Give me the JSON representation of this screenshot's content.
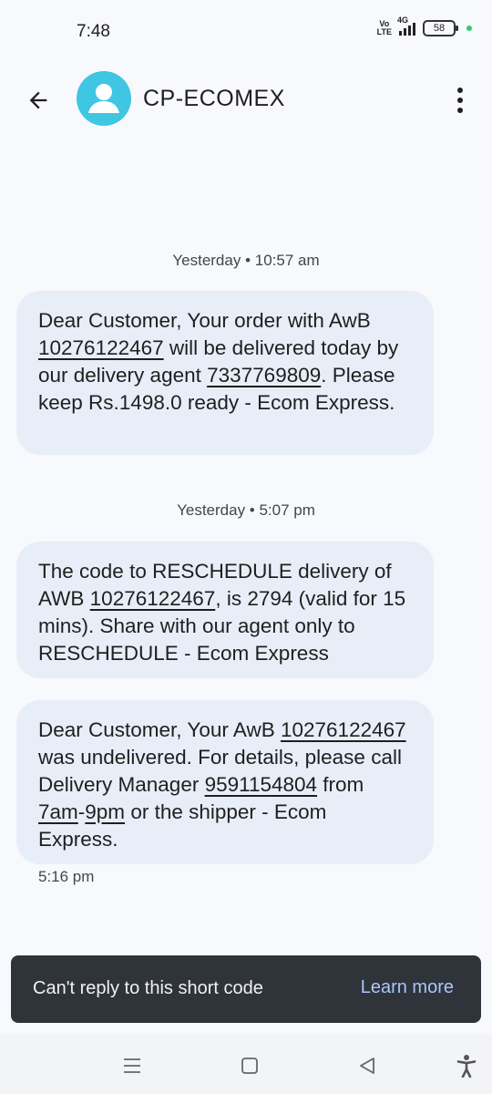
{
  "status_bar": {
    "time": "7:48",
    "volte_top": "Vo",
    "volte_bottom": "LTE",
    "network": "4G",
    "battery": "58"
  },
  "header": {
    "title": "CP-ECOMEX"
  },
  "messages": [
    {
      "timestamp": "Yesterday • 10:57 am",
      "parts": [
        "Dear Customer, Your order with AwB ",
        "10276122467",
        " will be delivered today by our delivery agent ",
        "7337769809",
        ". Please keep Rs.1498.0 ready - Ecom Express."
      ]
    },
    {
      "timestamp": "Yesterday • 5:07 pm",
      "parts": [
        "The code to RESCHEDULE delivery of AWB ",
        "10276122467",
        ", is 2794 (valid for 15 mins). Share with our agent only to RESCHEDULE - Ecom Express"
      ]
    },
    {
      "parts": [
        "Dear Customer, Your AwB ",
        "10276122467",
        " was undelivered. For details, please call Delivery Manager ",
        "9591154804",
        " from ",
        "7am",
        "-",
        "9pm",
        " or the shipper - Ecom Express."
      ],
      "time": "5:16 pm"
    }
  ],
  "snackbar": {
    "text": "Can't reply to this short code",
    "action": "Learn more"
  },
  "nav": {
    "icons": [
      "menu-icon",
      "home-square-icon",
      "back-triangle-icon",
      "accessibility-icon"
    ]
  }
}
